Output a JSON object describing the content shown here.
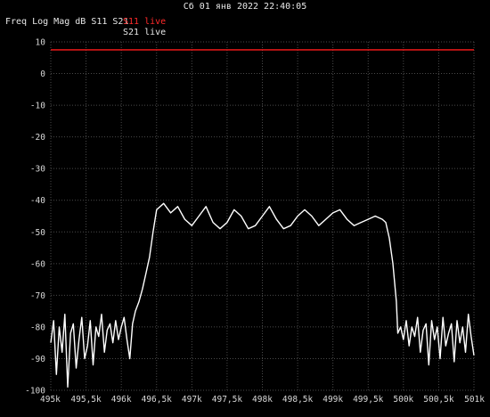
{
  "header": {
    "timestamp": "Сб 01 янв 2022 22:40:05",
    "title": "Freq Log Mag dB S11 S21"
  },
  "colors": {
    "background": "#000000",
    "grid": "#4a4a4a",
    "s11": "#ff1a1a",
    "s21": "#ffffff",
    "s11_label": "#ff2a2a"
  },
  "chart_data": {
    "type": "line",
    "xlabel": "",
    "ylabel": "",
    "x_unit": "kHz",
    "xlim": [
      495,
      501
    ],
    "ylim": [
      -100,
      10
    ],
    "grid": true,
    "legend": "top-left",
    "x_ticks": [
      495,
      495.5,
      496,
      496.5,
      497,
      497.5,
      498,
      498.5,
      499,
      499.5,
      500,
      500.5,
      501
    ],
    "x_tick_labels": [
      "495k",
      "495,5k",
      "496k",
      "496,5k",
      "497k",
      "497,5k",
      "498k",
      "498,5k",
      "499k",
      "499,5k",
      "500k",
      "500,5k",
      "501k"
    ],
    "y_ticks": [
      10,
      0,
      -10,
      -20,
      -30,
      -40,
      -50,
      -60,
      -70,
      -80,
      -90,
      -100
    ],
    "series": [
      {
        "name": "S11 live",
        "x": [
          495,
          501
        ],
        "y": [
          7.5,
          7.5
        ]
      },
      {
        "name": "S21 live",
        "x": [
          495.0,
          495.04,
          495.08,
          495.12,
          495.16,
          495.2,
          495.24,
          495.28,
          495.32,
          495.36,
          495.4,
          495.44,
          495.48,
          495.52,
          495.56,
          495.6,
          495.64,
          495.68,
          495.72,
          495.76,
          495.8,
          495.84,
          495.88,
          495.92,
          495.96,
          496.0,
          496.04,
          496.08,
          496.12,
          496.16,
          496.2,
          496.25,
          496.3,
          496.35,
          496.4,
          496.45,
          496.5,
          496.6,
          496.7,
          496.8,
          496.9,
          497.0,
          497.1,
          497.2,
          497.3,
          497.4,
          497.5,
          497.6,
          497.7,
          497.8,
          497.9,
          498.0,
          498.1,
          498.2,
          498.3,
          498.4,
          498.5,
          498.6,
          498.7,
          498.8,
          498.9,
          499.0,
          499.1,
          499.2,
          499.3,
          499.4,
          499.5,
          499.6,
          499.7,
          499.75,
          499.8,
          499.85,
          499.9,
          499.92,
          499.96,
          500.0,
          500.04,
          500.08,
          500.12,
          500.16,
          500.2,
          500.24,
          500.28,
          500.32,
          500.36,
          500.4,
          500.44,
          500.48,
          500.52,
          500.56,
          500.6,
          500.64,
          500.68,
          500.72,
          500.76,
          500.8,
          500.84,
          500.88,
          500.92,
          500.96,
          501.0
        ],
        "y": [
          -85,
          -78,
          -95,
          -80,
          -88,
          -76,
          -99,
          -82,
          -79,
          -93,
          -84,
          -77,
          -90,
          -86,
          -78,
          -92,
          -80,
          -83,
          -76,
          -88,
          -81,
          -79,
          -85,
          -78,
          -84,
          -80,
          -77,
          -84,
          -90,
          -79,
          -75,
          -72,
          -68,
          -63,
          -58,
          -50,
          -43,
          -41,
          -44,
          -42,
          -46,
          -48,
          -45,
          -42,
          -47,
          -49,
          -47,
          -43,
          -45,
          -49,
          -48,
          -45,
          -42,
          -46,
          -49,
          -48,
          -45,
          -43,
          -45,
          -48,
          -46,
          -44,
          -43,
          -46,
          -48,
          -47,
          -46,
          -45,
          -46,
          -47,
          -52,
          -60,
          -72,
          -82,
          -80,
          -84,
          -78,
          -86,
          -80,
          -83,
          -77,
          -88,
          -81,
          -79,
          -92,
          -78,
          -84,
          -80,
          -90,
          -77,
          -86,
          -82,
          -79,
          -91,
          -78,
          -85,
          -80,
          -88,
          -76,
          -83,
          -89
        ]
      }
    ]
  }
}
